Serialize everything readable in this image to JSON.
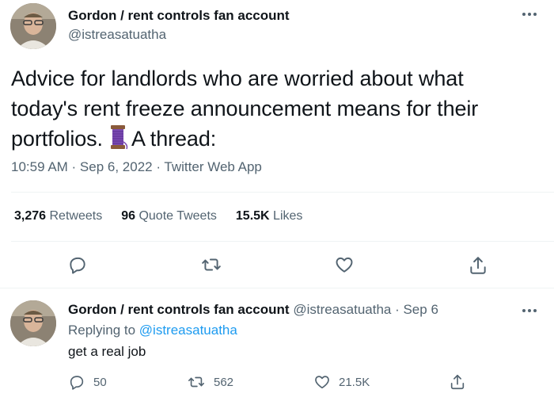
{
  "main_tweet": {
    "display_name": "Gordon / rent controls fan account",
    "handle": "@istreasatuatha",
    "text_before_emoji": "Advice for landlords who are worried about what today's rent freeze announcement means for their portfolios.",
    "emoji_icon": "thread-spool-icon",
    "text_after_emoji": "A thread:",
    "meta": "10:59 AM · Sep 6, 2022 · Twitter Web App",
    "stats": {
      "retweets_count": "3,276",
      "retweets_label": "Retweets",
      "quotes_count": "96",
      "quotes_label": "Quote Tweets",
      "likes_count": "15.5K",
      "likes_label": "Likes"
    },
    "actions": [
      "reply-icon",
      "retweet-icon",
      "like-icon",
      "share-icon"
    ]
  },
  "reply_tweet": {
    "display_name": "Gordon / rent controls fan account",
    "meta": "@istreasatuatha · Sep 6",
    "replying_to_label": "Replying to",
    "replying_to_handle": "@istreasatuatha",
    "text": "get a real job",
    "counts": {
      "replies": "50",
      "retweets": "562",
      "likes": "21.5K"
    }
  },
  "colors": {
    "text_primary": "#0f1419",
    "text_secondary": "#536471",
    "link": "#1d9bf0",
    "divider": "#eff3f4"
  }
}
